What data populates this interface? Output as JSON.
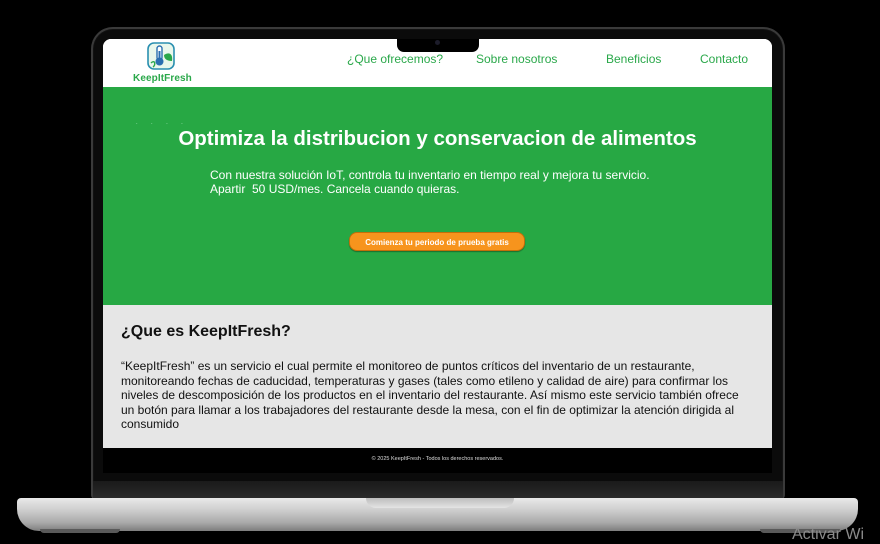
{
  "site": {
    "logo_text": "KeepItFresh",
    "nav": [
      {
        "label": "¿Que ofrecemos?"
      },
      {
        "label": "Sobre nosotros"
      },
      {
        "label": "Beneficios"
      },
      {
        "label": "Contacto"
      }
    ],
    "hero": {
      "title": "Optimiza la distribucion y conservacion de alimentos",
      "subtitle_line1": "Con nuestra solución IoT, controla tu inventario en tiempo real y mejora tu servicio.",
      "subtitle_line2": "Apartir  50 USD/mes. Cancela cuando quieras.",
      "cta_label": "Comienza tu periodo de prueba gratis"
    },
    "about": {
      "title": "¿Que es KeepItFresh?",
      "body": "“KeepItFresh” es un servicio el cual permite el monitoreo de puntos críticos del inventario de un restaurante, monitoreando fechas de caducidad, temperaturas y gases (tales como etileno y calidad de aire) para confirmar los niveles de descomposición de los productos en el inventario del restaurante. Así mismo este servicio también ofrece un botón para llamar a los trabajadores del restaurante desde la mesa, con el fin de optimizar la atención dirigida al consumido"
    },
    "footer_text": "© 2025 KeepItFresh - Todos los derechos reservados."
  },
  "overlay": {
    "watermark": "Activar Wi"
  },
  "colors": {
    "brand_green": "#27a844",
    "cta_orange": "#f7941d",
    "about_bg": "#e6e6e6"
  }
}
